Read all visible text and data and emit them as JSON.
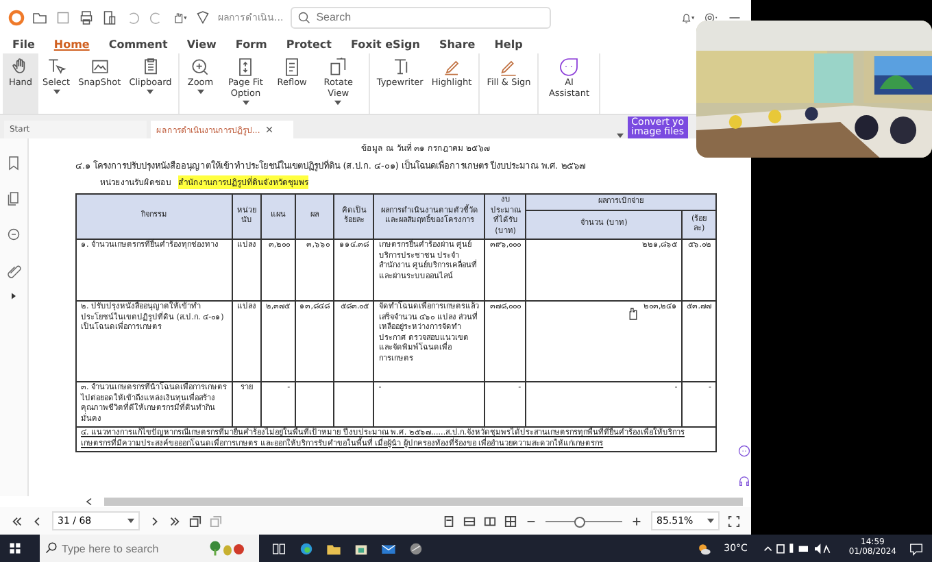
{
  "app": {
    "title": "ผลการดำเนิน...",
    "search": {
      "placeholder": "Search"
    }
  },
  "menu": [
    {
      "label": "File",
      "selected": false
    },
    {
      "label": "Home",
      "selected": true
    },
    {
      "label": "Comment",
      "selected": false
    },
    {
      "label": "View",
      "selected": false
    },
    {
      "label": "Form",
      "selected": false
    },
    {
      "label": "Protect",
      "selected": false
    },
    {
      "label": "Foxit eSign",
      "selected": false
    },
    {
      "label": "Share",
      "selected": false
    },
    {
      "label": "Help",
      "selected": false
    }
  ],
  "ribbon": [
    [
      {
        "label": "Hand",
        "kind": "hand",
        "selected": true,
        "dropdown": false
      },
      {
        "label": "Select",
        "kind": "select",
        "selected": false,
        "dropdown": true
      },
      {
        "label": "SnapShot",
        "kind": "snapshot",
        "selected": false,
        "dropdown": false
      },
      {
        "label": "Clipboard",
        "kind": "clipboard",
        "selected": false,
        "dropdown": true
      }
    ],
    [
      {
        "label": "Zoom",
        "kind": "zoom",
        "selected": false,
        "dropdown": true
      },
      {
        "label": "Page Fit Option",
        "kind": "pagefit",
        "selected": false,
        "dropdown": true
      },
      {
        "label": "Reflow",
        "kind": "reflow",
        "selected": false,
        "dropdown": false
      },
      {
        "label": "Rotate View",
        "kind": "rotate",
        "selected": false,
        "dropdown": true
      }
    ],
    [
      {
        "label": "Typewriter",
        "kind": "typewriter",
        "selected": false,
        "dropdown": false
      },
      {
        "label": "Highlight",
        "kind": "highlight",
        "selected": false,
        "dropdown": false
      }
    ],
    [
      {
        "label": "Fill & Sign",
        "kind": "fill",
        "selected": false,
        "dropdown": false
      }
    ],
    [
      {
        "label": "AI Assistant",
        "kind": "ai",
        "selected": false,
        "dropdown": false
      }
    ]
  ],
  "doc_tabs": [
    {
      "label": "Start",
      "selected": false,
      "closable": false
    },
    {
      "label": "ผลการดำเนินงานการปฏิรูป...",
      "selected": true,
      "closable": true
    }
  ],
  "banner": [
    "Convert yo",
    "image files"
  ],
  "document": {
    "date_line": "ข้อมูล ณ วันที่ ๓๑ กรกฎาคม ๒๕๖๗",
    "heading": "๔.๑ โครงการปรับปรุงหนังสืออนุญาตให้เข้าทำประโยชน์ในเขตปฏิรูปที่ดิน (ส.ป.ก. ๔-๐๑) เป็นโฉนดเพื่อการเกษตร ปีงบประมาณ พ.ศ. ๒๕๖๗",
    "agency_label": "หน่วยงานรับผิดชอบ",
    "agency": "สำนักงานการปฏิรูปที่ดินจังหวัดชุมพร",
    "table": {
      "columns": [
        "กิจกรรม",
        "หน่วยนับ",
        "แผน",
        "ผล",
        "คิดเป็นร้อยละ",
        "ผลการดำเนินงานตามตัวชี้วัดและผลสัมฤทธิ์ของโครงการ",
        "งบประมาณที่ได้รับ (บาท)"
      ],
      "group_column": {
        "label": "ผลการเบิกจ่าย",
        "sub": [
          "จำนวน (บาท)",
          "(ร้อยละ)"
        ]
      },
      "rows": [
        [
          "๑. จำนวนเกษตรกรที่ยื่นคำร้องทุกช่องทาง",
          "แปลง",
          "๓,๒๐๐",
          "๓,๖๖๐",
          "๑๑๔.๓๘",
          "เกษตรกรยื่นคำร้องผ่าน ศูนย์บริการประชาชน ประจำสำนักงาน ศูนย์บริการเคลื่อนที่ และผ่านระบบออนไลน์",
          "๓๙๖,๐๐๐",
          "๒๒๑,๘๖๕",
          "๕๖.๐๒"
        ],
        [
          "๒. ปรับปรุงหนังสืออนุญาตให้เข้าทำประโยชน์ในเขตปฏิรูปที่ดิน (ส.ป.ก. ๔-๐๑) เป็นโฉนดเพื่อการเกษตร",
          "แปลง",
          "๒,๓๗๕",
          "๑๓,๘๔๘",
          "๕๘๓.๐๕",
          "จัดทำโฉนดเพื่อการเกษตรแล้วเสร็จจำนวน ๔๖๐ แปลง ส่วนที่เหลืออยู่ระหว่างการจัดทำประกาศ ตรวจสอบแนวเขต และจัดพิมพ์โฉนดเพื่อการเกษตร",
          "๓๗๘,๐๐๐",
          "๒๐๓,๒๔๑",
          "๕๓.๗๗"
        ],
        [
          "๓. จำนวนเกษตรกรที่นำโฉนดเพื่อการเกษตรไปต่อยอดให้เข้าถึงแหล่งเงินทุนเพื่อสร้างคุณภาพชีวิตที่ดีให้เกษตรกรมีที่ดินทำกินมั่นคง",
          "ราย",
          "-",
          "",
          "",
          "-",
          "-",
          "-",
          "-"
        ]
      ]
    },
    "note": "๔. แนวทางการแก้ไขปัญหากรณีเกษตรกรที่มายื่นคำร้องไม่อยู่ในพื้นที่เป้าหมาย ปีงบประมาณ พ.ศ. ๒๕๖๗......ส.ป.ก.จังหวัดชุมพรได้ประสานเกษตรกรทุกพื้นที่ที่ยื่นคำร้องเพื่อให้บริการเกษตรกรที่มีความประสงค์ขอออกโฉนดเพื่อการเกษตร และออกให้บริการรับคำขอในพื้นที่ เมื่อผู้นำ ผู้ปกครองท้องที่ร้องขอ เพื่ออำนวยความสะดวกให้แก่เกษตรกร"
  },
  "nav": {
    "page": "31 / 68",
    "zoom": "85.51%",
    "level": 0.45
  },
  "taskbar": {
    "search": {
      "placeholder": "Type here to search"
    },
    "temperature": "30°C",
    "time": "14:59",
    "date": "01/08/2024"
  },
  "video": {
    "kind": "picture"
  }
}
